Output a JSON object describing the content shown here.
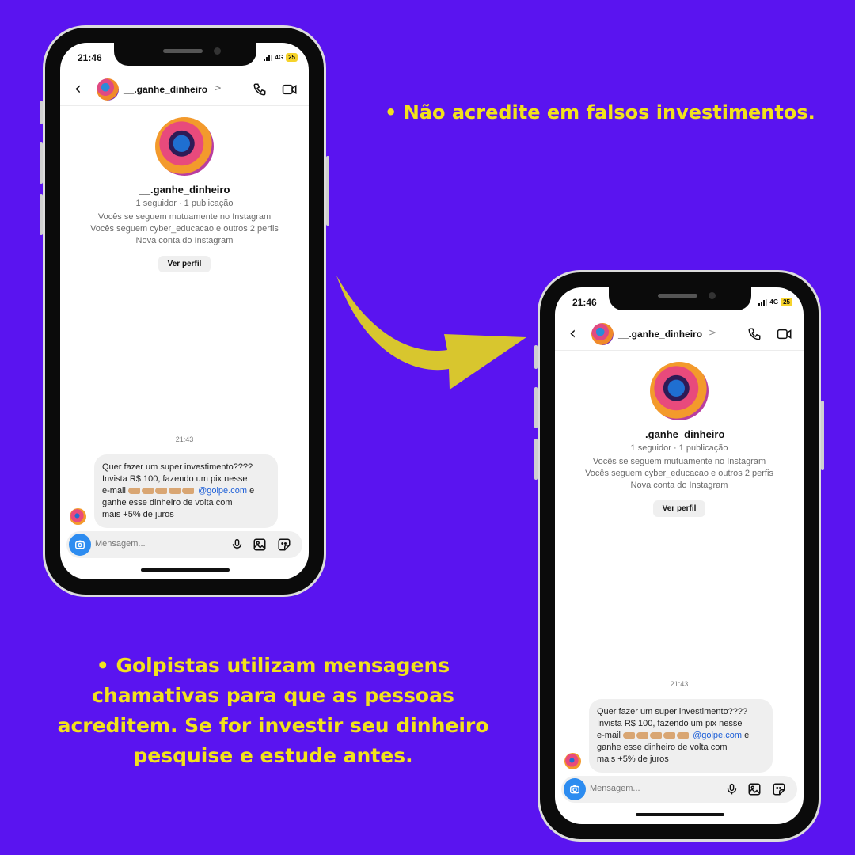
{
  "captions": {
    "top_right": "• Não acredite em falsos investimentos.",
    "bottom_left": "• Golpistas utilizam mensagens chamativas para que as pessoas acreditem. Se for investir seu dinheiro pesquise e estude antes."
  },
  "phone": {
    "status": {
      "time": "21:46",
      "network": "4G",
      "battery": "25"
    },
    "header": {
      "username": "__.ganhe_dinheiro",
      "chevron": ">"
    },
    "profile": {
      "name": "__.ganhe_dinheiro",
      "stats": "1 seguidor · 1 publicação",
      "mutual": "Vocês se seguem mutuamente no Instagram",
      "following": "Vocês seguem cyber_educacao e outros 2 perfis",
      "new_account": "Nova conta do Instagram",
      "view_profile": "Ver perfil"
    },
    "timestamp": "21:43",
    "message": {
      "line1": "Quer fazer um super investimento????",
      "line2": "Invista R$ 100, fazendo um pix nesse",
      "line3_prefix": "e-mail",
      "mention": "@golpe.com",
      "line3_suffix": "e",
      "line4": "ganhe esse dinheiro de volta com",
      "line5": "mais +5% de juros"
    },
    "composer": {
      "placeholder": "Mensagem..."
    }
  },
  "colors": {
    "background": "#5a14f0",
    "caption": "#f2e21c",
    "arrow": "#d8c62e",
    "mention": "#1d5fd8"
  }
}
